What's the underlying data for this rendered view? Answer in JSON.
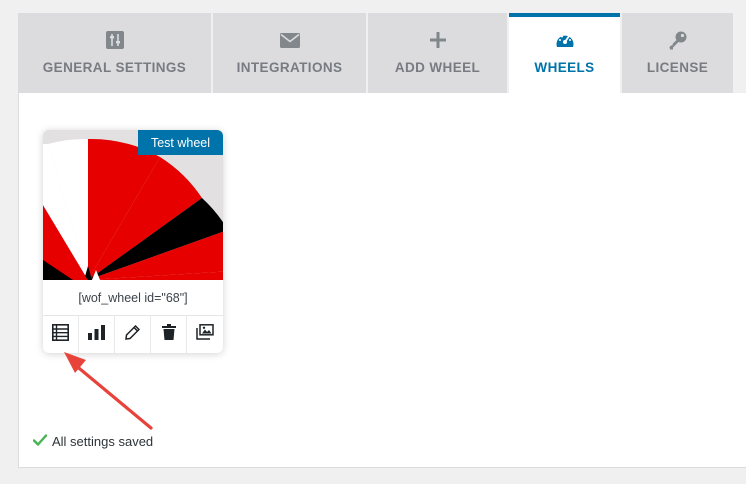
{
  "tabs": [
    {
      "label": "GENERAL SETTINGS",
      "icon": "sliders-icon",
      "active": false
    },
    {
      "label": "INTEGRATIONS",
      "icon": "envelope-icon",
      "active": false
    },
    {
      "label": "ADD WHEEL",
      "icon": "plus-icon",
      "active": false
    },
    {
      "label": "WHEELS",
      "icon": "dashboard-icon",
      "active": true
    },
    {
      "label": "LICENSE",
      "icon": "key-icon",
      "active": false
    }
  ],
  "wheel_card": {
    "name": "Test wheel",
    "shortcode": "[wof_wheel id=\"68\"]",
    "actions": [
      "list-icon",
      "bar-chart-icon",
      "pencil-icon",
      "trash-icon",
      "images-icon"
    ],
    "wheel_colors": [
      "#e60000",
      "#000000",
      "#ffffff"
    ]
  },
  "status": {
    "text": "All settings saved",
    "color": "#46b450"
  },
  "colors": {
    "accent": "#0073aa",
    "tab_inactive": "#dcdcde",
    "annotation_arrow": "#e8433a"
  }
}
